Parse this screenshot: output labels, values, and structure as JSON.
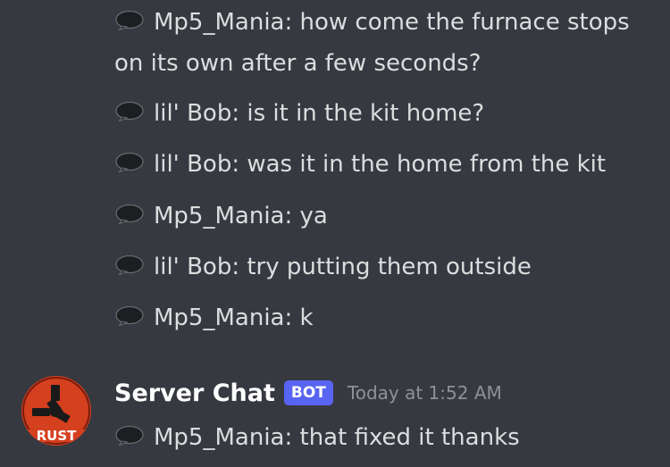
{
  "messages_above": [
    {
      "icon": "speech-bubble-icon",
      "text": "Mp5_Mania: how come the furnace stops on its own after a few seconds?"
    },
    {
      "icon": "speech-bubble-icon",
      "text": "lil' Bob: is it in the kit home?"
    },
    {
      "icon": "speech-bubble-icon",
      "text": "lil' Bob: was it in the home from the kit"
    },
    {
      "icon": "speech-bubble-icon",
      "text": "Mp5_Mania: ya"
    },
    {
      "icon": "speech-bubble-icon",
      "text": "lil' Bob: try putting them outside"
    },
    {
      "icon": "speech-bubble-icon",
      "text": "Mp5_Mania: k"
    }
  ],
  "group": {
    "avatar_text": "RUST",
    "username": "Server Chat",
    "bot_tag": "BOT",
    "timestamp": "Today at 1:52 AM",
    "message": {
      "icon": "speech-bubble-icon",
      "text": "Mp5_Mania: that fixed it thanks"
    }
  },
  "colors": {
    "background": "#36393f",
    "text": "#dcddde",
    "username": "#ffffff",
    "bot_tag": "#5865f2",
    "timestamp": "#8e9297",
    "avatar": "#d5401f"
  }
}
